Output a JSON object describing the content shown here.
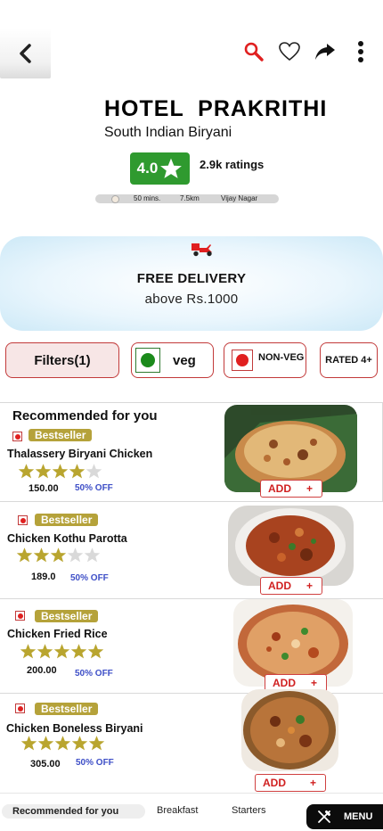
{
  "header": {
    "back_icon": "chevron-left-icon",
    "icons": [
      "search-icon",
      "heart-icon",
      "share-icon",
      "more-vertical-icon"
    ],
    "search_color": "#e02020"
  },
  "restaurant": {
    "name": "HOTEL  PRAKRITHI",
    "cuisine": "South Indian Biryani",
    "rating": "4.0",
    "ratings_count": "2.9k ratings",
    "delivery_time": "50 mins.",
    "distance": "7.5km",
    "location": "Vijay Nagar"
  },
  "delivery_banner": {
    "title": "FREE DELIVERY",
    "subtitle": "above Rs.1000",
    "icon": "scooter-icon"
  },
  "filters": {
    "filters_label": "Filters(1)",
    "veg_label": "veg",
    "nonveg_label": "NON-VEG",
    "rated_label": "RATED 4+"
  },
  "section": {
    "title": "Recommended for you"
  },
  "items": [
    {
      "badge": "Bestseller",
      "name": "Thalassery Biryani Chicken",
      "rating": 4,
      "price": "150.00",
      "discount": "50% OFF",
      "add_label": "ADD",
      "add_plus": "+"
    },
    {
      "badge": "Bestseller",
      "name": "Chicken Kothu Parotta",
      "rating": 3,
      "price": "189.0",
      "discount": "50% OFF",
      "add_label": "ADD",
      "add_plus": "+"
    },
    {
      "badge": "Bestseller",
      "name": "Chicken Fried Rice",
      "rating": 5,
      "price": "200.00",
      "discount": "50% OFF",
      "add_label": "ADD",
      "add_plus": "+"
    },
    {
      "badge": "Bestseller",
      "name": "Chicken Boneless Biryani",
      "rating": 5,
      "price": "305.00",
      "discount": "50% OFF",
      "add_label": "ADD",
      "add_plus": "+"
    }
  ],
  "bottom_tabs": {
    "tabs": [
      "Recommended for you",
      "Breakfast",
      "Starters"
    ],
    "menu_label": "MENU",
    "menu_icon": "fork-knife-icon"
  },
  "colors": {
    "rating_green": "#2f9a2f",
    "bestseller_gold": "#b5a23a",
    "accent_red": "#c23a3a",
    "discount_blue": "#3e4fc7",
    "star_gold": "#b9a52f"
  }
}
